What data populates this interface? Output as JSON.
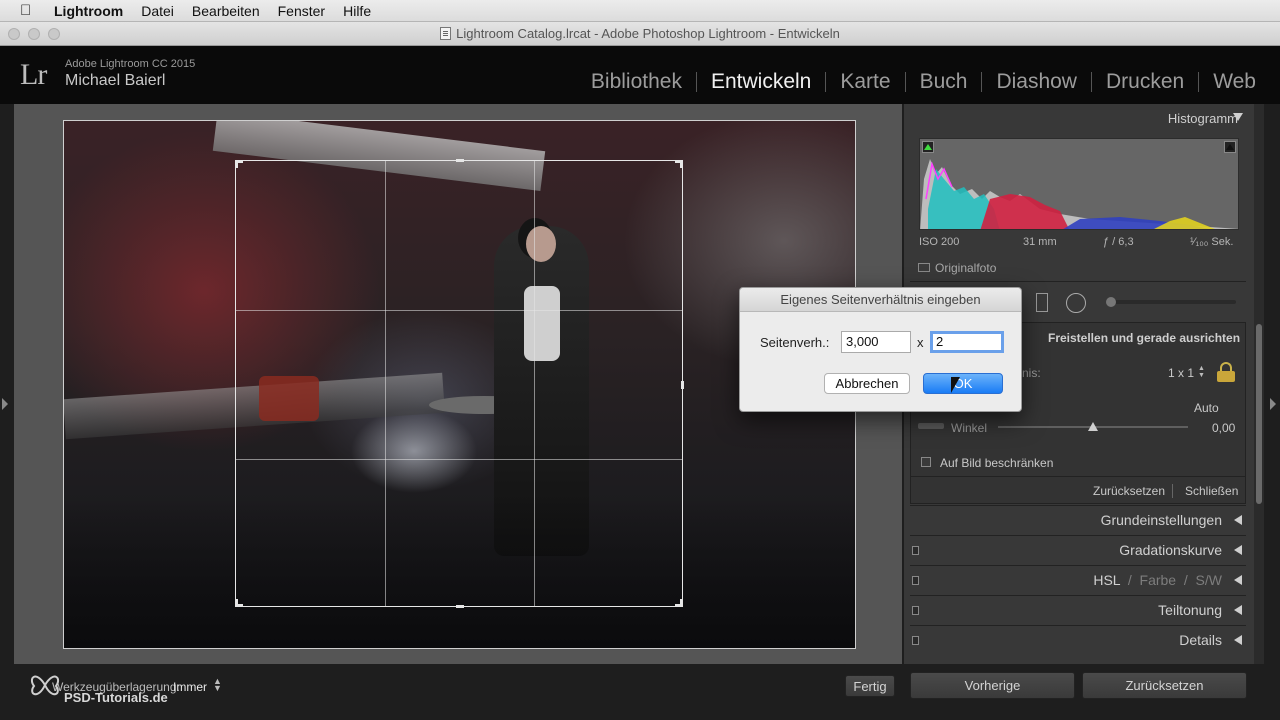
{
  "menubar": {
    "app": "Lightroom",
    "items": [
      "Datei",
      "Bearbeiten",
      "Fenster",
      "Hilfe"
    ]
  },
  "window": {
    "title": "Lightroom Catalog.lrcat - Adobe Photoshop Lightroom - Entwickeln"
  },
  "identity": {
    "logo": "Lr",
    "version": "Adobe Lightroom CC 2015",
    "user": "Michael Baierl"
  },
  "modules": [
    "Bibliothek",
    "Entwickeln",
    "Karte",
    "Buch",
    "Diashow",
    "Drucken",
    "Web"
  ],
  "active_module": "Entwickeln",
  "toolbar": {
    "overlay_label": "Werkzeugüberlagerung:",
    "overlay_value": "Immer",
    "done_label": "Fertig",
    "watermark": "PSD-Tutorials.de"
  },
  "histogram": {
    "title": "Histogramm",
    "iso": "ISO 200",
    "focal": "31 mm",
    "aperture": "ƒ / 6,3",
    "shutter": "¹⁄₁₀₀ Sek.",
    "original_label": "Originalfoto"
  },
  "crop_panel": {
    "title": "Freistellen und gerade ausrichten",
    "aspect_partial": "nis:",
    "aspect_value": "1 x 1",
    "auto_label": "Auto",
    "angle_label": "Winkel",
    "angle_value": "0,00",
    "angle_fraction": 0.5,
    "constrain_label": "Auf Bild beschränken",
    "reset_label": "Zurücksetzen",
    "close_label": "Schließen"
  },
  "sections": {
    "basic": "Grundeinstellungen",
    "tone_curve": "Gradationskurve",
    "hsl": "HSL",
    "color": "Farbe",
    "bw": "S/W",
    "split": "Teiltonung",
    "details": "Details"
  },
  "bottom_buttons": {
    "previous": "Vorherige",
    "reset": "Zurücksetzen"
  },
  "dialog": {
    "title": "Eigenes Seitenverhältnis eingeben",
    "label": "Seitenverh.:",
    "value1": "3,000",
    "separator": "x",
    "value2": "2",
    "cancel": "Abbrechen",
    "ok": "OK"
  },
  "colors": {
    "accent": "#1a7cf5",
    "panel": "#383838",
    "background": "#555555"
  }
}
